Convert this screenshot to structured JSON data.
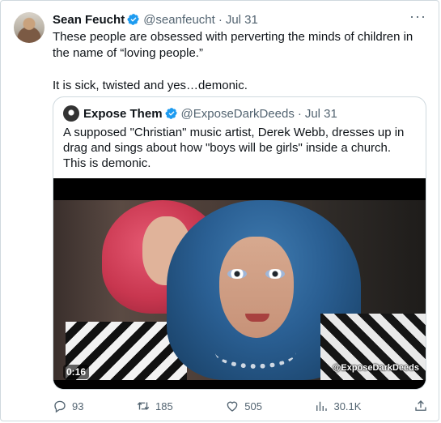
{
  "author": {
    "name": "Sean Feucht",
    "handle": "@seanfeucht",
    "separator": "·",
    "date": "Jul 31"
  },
  "tweet": {
    "text": "These people are obsessed with perverting the minds of children in the name of “loving people.”\n\nIt is sick, twisted and yes…demonic."
  },
  "quoted": {
    "name": "Expose Them",
    "handle": "@ExposeDarkDeeds",
    "separator": "·",
    "date": "Jul 31",
    "text": "A supposed \"Christian\" music artist, Derek Webb, dresses up in drag and sings about how \"boys will be girls\" inside a church. This is demonic.",
    "video": {
      "duration": "0:16",
      "watermark": "@ExposeDarkDeeds"
    }
  },
  "actions": {
    "replies": "93",
    "retweets": "185",
    "likes": "505",
    "views": "30.1K"
  },
  "colors": {
    "verified": "#1d9bf0",
    "muted": "#536471",
    "border": "#cfd9de"
  }
}
